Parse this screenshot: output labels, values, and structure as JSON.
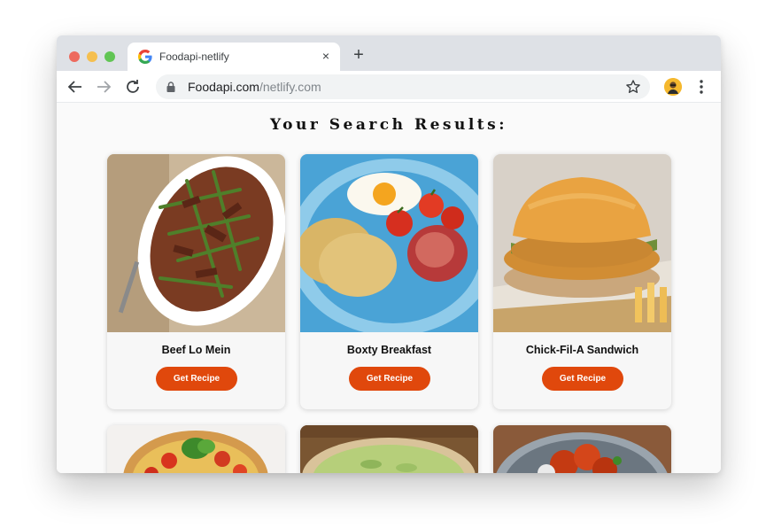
{
  "browser": {
    "tab_title": "Foodapi-netlify",
    "tab_close": "×",
    "new_tab": "+",
    "url_domain": "Foodapi.com",
    "url_path": "/netlify.com"
  },
  "page": {
    "heading": "Your Search Results:",
    "cards": [
      {
        "name": "Beef Lo Mein",
        "button": "Get Recipe"
      },
      {
        "name": "Boxty Breakfast",
        "button": "Get Recipe"
      },
      {
        "name": "Chick-Fil-A Sandwich",
        "button": "Get Recipe"
      }
    ]
  },
  "colors": {
    "accent_button": "#e0480c",
    "tabstrip": "#dee1e6"
  },
  "icons": [
    "google-icon",
    "close-icon",
    "plus-icon",
    "back-arrow-icon",
    "forward-arrow-icon",
    "reload-icon",
    "lock-icon",
    "star-icon",
    "avatar-icon",
    "kebab-menu-icon"
  ]
}
